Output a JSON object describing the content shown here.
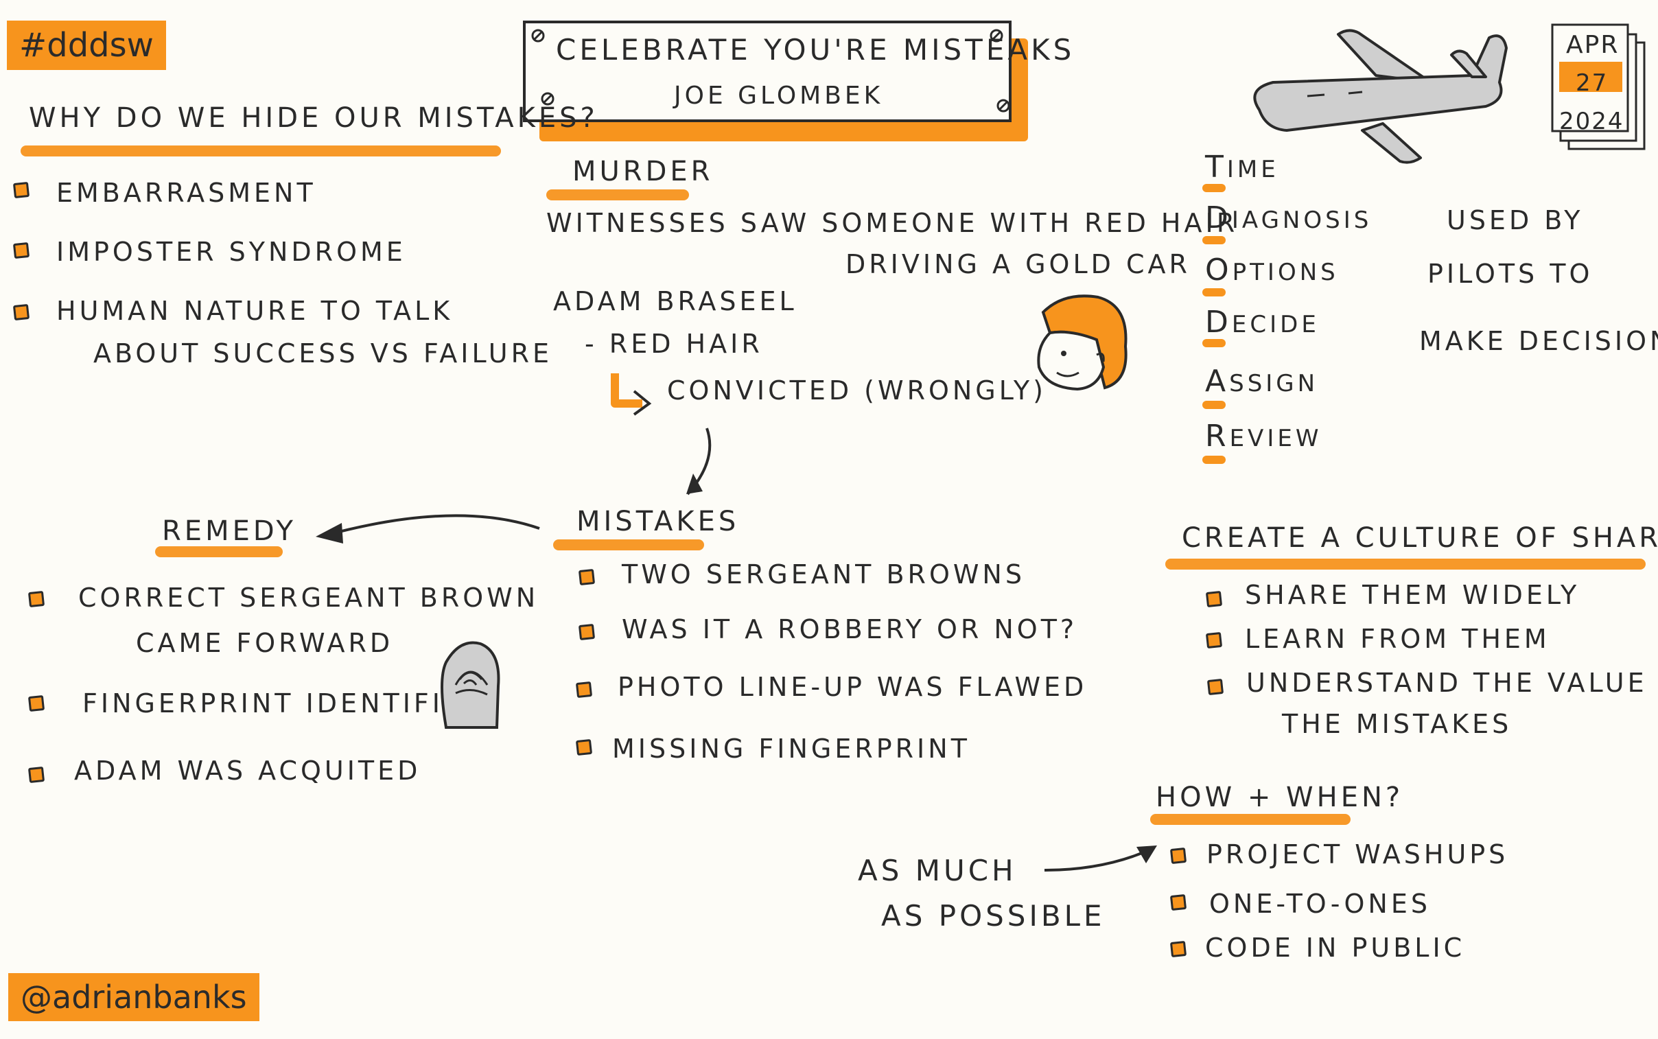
{
  "hashtag": "#dddsw",
  "author_handle": "@adrianbanks",
  "title": {
    "line1": "Celebrate You're Misteaks",
    "speaker": "Joe Glombek"
  },
  "calendar": {
    "month": "APR",
    "day": "27",
    "year": "2024"
  },
  "why_hide": {
    "heading": "Why do we hide our mistakes?",
    "items": [
      "Embarrasment",
      "Imposter syndrome",
      "Human nature to talk",
      "About success vs failure"
    ]
  },
  "murder": {
    "heading": "Murder",
    "witness_line1": "Witnesses saw someone with red hair",
    "witness_line2": "driving a gold car",
    "suspect": "Adam Braseel",
    "trait": "- red hair",
    "outcome": "convicted (wrongly)"
  },
  "mistakes": {
    "heading": "Mistakes",
    "items": [
      "Two Sergeant Browns",
      "Was it a robbery or not?",
      "Photo line-up was flawed",
      "Missing fingerprint"
    ]
  },
  "remedy": {
    "heading": "Remedy",
    "items": [
      "Correct Sergeant Brown",
      "came forward",
      "Fingerprint identified",
      "Adam was acquited"
    ]
  },
  "todar": {
    "letters": [
      {
        "initial": "T",
        "rest": "ime"
      },
      {
        "initial": "D",
        "rest": "iagnosis"
      },
      {
        "initial": "O",
        "rest": "ptions"
      },
      {
        "initial": "D",
        "rest": "ecide"
      },
      {
        "initial": "A",
        "rest": "ssign"
      },
      {
        "initial": "R",
        "rest": "eview"
      }
    ],
    "note_line1": "Used by",
    "note_line2": "pilots to",
    "note_line3": "make decisions"
  },
  "culture": {
    "heading": "Create a culture of sharing",
    "items": [
      "Share them widely",
      "Learn from them",
      "Understand the value of",
      "the mistakes"
    ]
  },
  "how_when": {
    "heading": "How + When?",
    "items": [
      "Project washups",
      "One-to-ones",
      "Code in public"
    ],
    "frequency_line1": "As much",
    "frequency_line2": "as possible"
  },
  "colors": {
    "accent": "#f7941d",
    "ink": "#2a2a2a",
    "paper": "#fdfcf7",
    "grey": "#cfcfcf"
  },
  "icons": [
    "airplane-icon",
    "calendar-icon",
    "red-haired-face-icon",
    "fingerprint-icon",
    "arrow-icon"
  ]
}
